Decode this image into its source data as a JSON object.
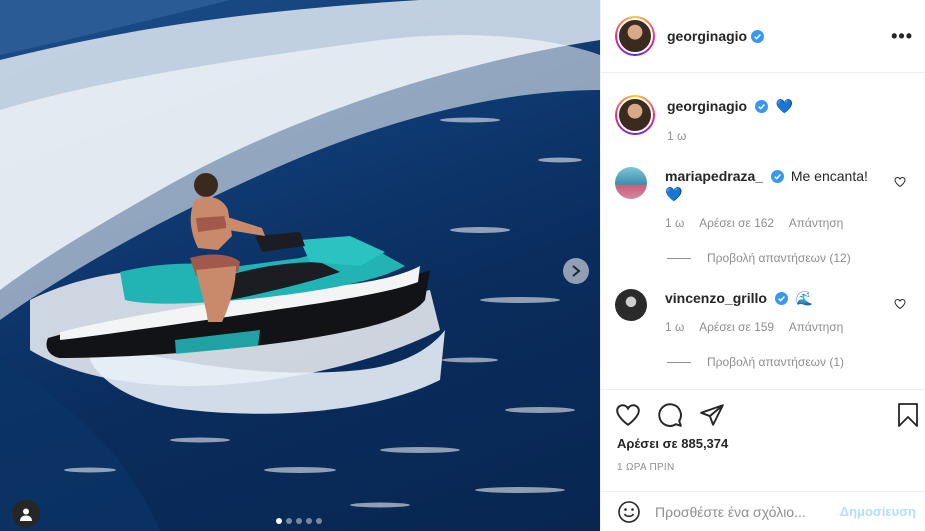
{
  "post": {
    "author": "georginagio",
    "carousel_total": 5,
    "carousel_active": 0
  },
  "caption": {
    "author": "georginagio",
    "emoji": "💙",
    "time": "1 ω"
  },
  "comments": [
    {
      "author": "mariapedraza_",
      "text": "Me encanta!",
      "emoji": "💙",
      "time": "1 ω",
      "likes": "Αρέσει σε 162",
      "reply": "Απάντηση",
      "view_replies": "Προβολή απαντήσεων (12)"
    },
    {
      "author": "vincenzo_grillo",
      "emoji": "🌊",
      "time": "1 ω",
      "likes": "Αρέσει σε 159",
      "reply": "Απάντηση",
      "view_replies": "Προβολή απαντήσεων (1)"
    }
  ],
  "stats": {
    "likes": "Αρέσει σε 885,374",
    "posted": "1 ΩΡΑ ΠΡΙΝ"
  },
  "composer": {
    "placeholder": "Προσθέστε ένα σχόλιο...",
    "post_label": "Δημοσίευση"
  },
  "colors": {
    "verified": "#3897f0",
    "heart_emoji": "#1e6fd9",
    "post_disabled": "#b2dffc",
    "jetski_accent": "#22b3b5"
  }
}
